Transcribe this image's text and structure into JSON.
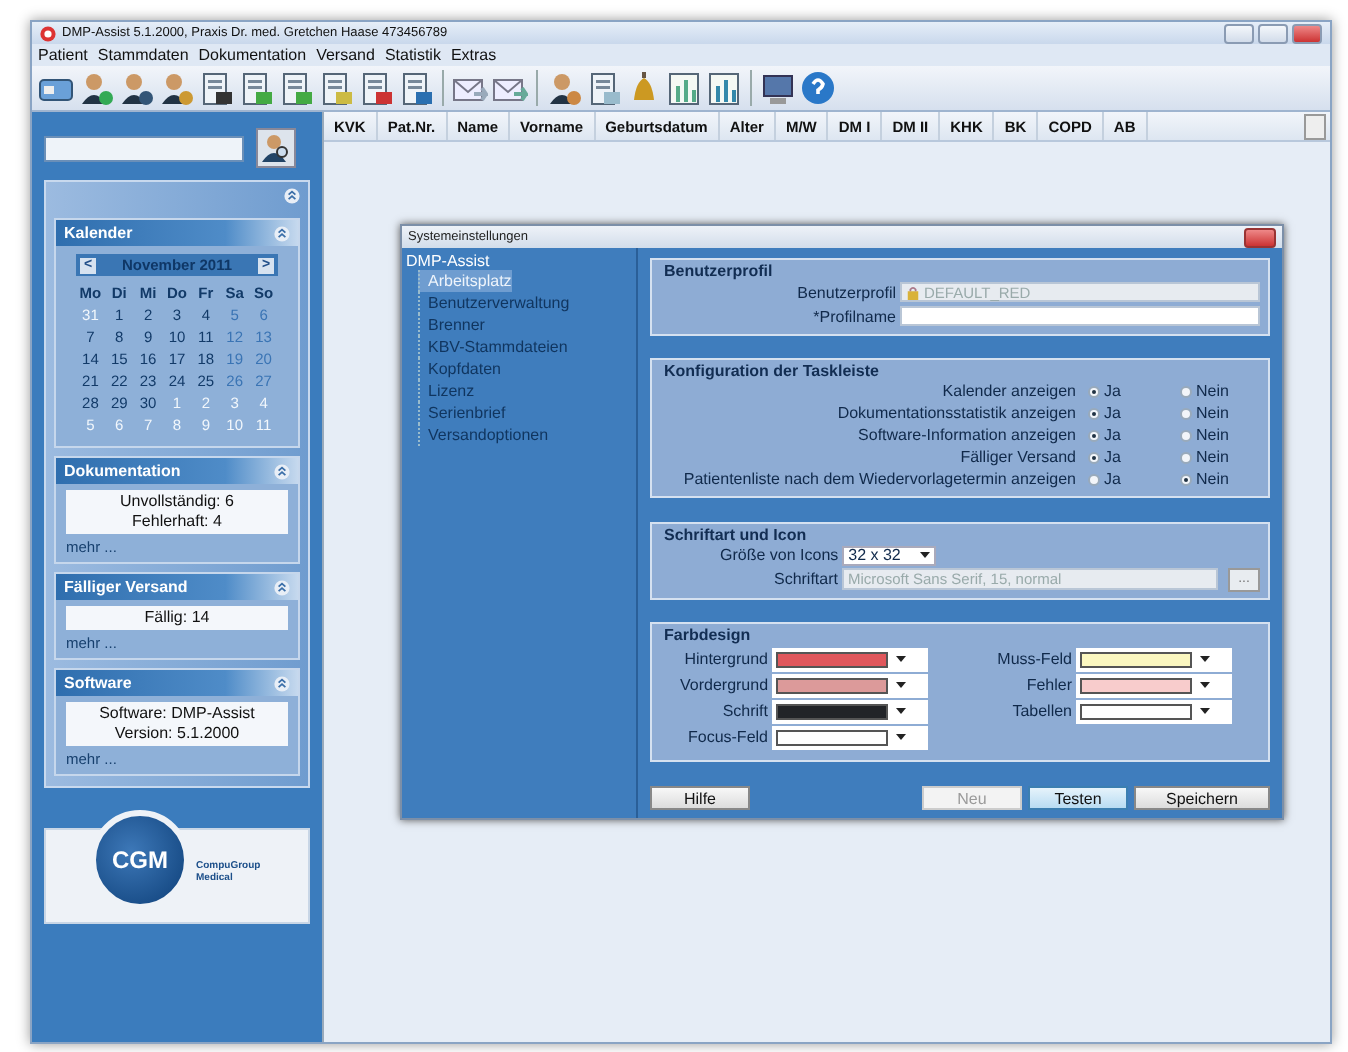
{
  "window": {
    "title": "DMP-Assist 5.1.2000, Praxis Dr. med. Gretchen Haase 473456789"
  },
  "menu": [
    "Patient",
    "Stammdaten",
    "Dokumentation",
    "Versand",
    "Statistik",
    "Extras"
  ],
  "sidebar": {
    "calendar": {
      "title": "Kalender",
      "month": "November 2011",
      "prev": "<",
      "next": ">",
      "weekdays": [
        "Mo",
        "Di",
        "Mi",
        "Do",
        "Fr",
        "Sa",
        "So"
      ],
      "weeks": [
        [
          {
            "day": "31",
            "muted": true
          },
          {
            "day": "1",
            "muted": false
          },
          {
            "day": "2",
            "muted": false
          },
          {
            "day": "3",
            "muted": false
          },
          {
            "day": "4",
            "muted": false
          },
          {
            "day": "5",
            "muted": false
          },
          {
            "day": "6",
            "muted": false
          }
        ],
        [
          {
            "day": "7",
            "muted": false
          },
          {
            "day": "8",
            "muted": false
          },
          {
            "day": "9",
            "muted": false
          },
          {
            "day": "10",
            "muted": false
          },
          {
            "day": "11",
            "muted": false
          },
          {
            "day": "12",
            "muted": false
          },
          {
            "day": "13",
            "muted": false
          }
        ],
        [
          {
            "day": "14",
            "muted": false
          },
          {
            "day": "15",
            "muted": false
          },
          {
            "day": "16",
            "muted": false
          },
          {
            "day": "17",
            "muted": false
          },
          {
            "day": "18",
            "muted": false
          },
          {
            "day": "19",
            "muted": false
          },
          {
            "day": "20",
            "muted": false
          }
        ],
        [
          {
            "day": "21",
            "muted": false
          },
          {
            "day": "22",
            "muted": false
          },
          {
            "day": "23",
            "muted": false
          },
          {
            "day": "24",
            "muted": false
          },
          {
            "day": "25",
            "muted": false
          },
          {
            "day": "26",
            "muted": false
          },
          {
            "day": "27",
            "muted": false
          }
        ],
        [
          {
            "day": "28",
            "muted": false
          },
          {
            "day": "29",
            "muted": false
          },
          {
            "day": "30",
            "muted": false
          },
          {
            "day": "1",
            "muted": true
          },
          {
            "day": "2",
            "muted": true
          },
          {
            "day": "3",
            "muted": true
          },
          {
            "day": "4",
            "muted": true
          }
        ],
        [
          {
            "day": "5",
            "muted": true
          },
          {
            "day": "6",
            "muted": true
          },
          {
            "day": "7",
            "muted": true
          },
          {
            "day": "8",
            "muted": true
          },
          {
            "day": "9",
            "muted": true
          },
          {
            "day": "10",
            "muted": true
          },
          {
            "day": "11",
            "muted": true
          }
        ]
      ]
    },
    "sections": [
      {
        "title": "Dokumentation",
        "lines": [
          "Unvollständig: 6",
          "Fehlerhaft: 4"
        ],
        "link": "mehr ..."
      },
      {
        "title": "Fälliger Versand",
        "lines": [
          "Fällig: 14"
        ],
        "link": "mehr ..."
      },
      {
        "title": "Software",
        "lines": [
          "Software: DMP-Assist",
          "Version: 5.1.2000"
        ],
        "link": "mehr ..."
      }
    ],
    "logo": {
      "mark": "CGM",
      "name": "CompuGroup Medical"
    }
  },
  "table": {
    "columns": [
      "KVK",
      "Pat.Nr.",
      "Name",
      "Vorname",
      "Geburtsdatum",
      "Alter",
      "M/W",
      "DM I",
      "DM II",
      "KHK",
      "BK",
      "COPD",
      "AB"
    ]
  },
  "dialog": {
    "title": "Systemeinstellungen",
    "tree": {
      "label": "DMP-Assist",
      "children": [
        {
          "label": "Arbeitsplatz",
          "selected": true
        },
        {
          "label": "Benutzerverwaltung",
          "selected": false
        },
        {
          "label": "Brenner",
          "selected": false
        },
        {
          "label": "KBV-Stammdateien",
          "selected": false
        },
        {
          "label": "Kopfdaten",
          "selected": false
        },
        {
          "label": "Lizenz",
          "selected": false
        },
        {
          "label": "Serienbrief",
          "selected": false
        },
        {
          "label": "Versandoptionen",
          "selected": false
        }
      ]
    },
    "profile": {
      "title": "Benutzerprofil",
      "profile_label": "Benutzerprofil",
      "profile_value": "DEFAULT_RED",
      "name_label": "*Profilname"
    },
    "taskbar": {
      "title": "Konfiguration der Taskleiste",
      "rows": [
        {
          "label": "Kalender anzeigen",
          "options": [
            {
              "label": "Ja",
              "selected": true
            },
            {
              "label": "Nein",
              "selected": false
            }
          ]
        },
        {
          "label": "Dokumentationsstatistik anzeigen",
          "options": [
            {
              "label": "Ja",
              "selected": true
            },
            {
              "label": "Nein",
              "selected": false
            }
          ]
        },
        {
          "label": "Software-Information anzeigen",
          "options": [
            {
              "label": "Ja",
              "selected": true
            },
            {
              "label": "Nein",
              "selected": false
            }
          ]
        },
        {
          "label": "Fälliger Versand",
          "options": [
            {
              "label": "Ja",
              "selected": true
            },
            {
              "label": "Nein",
              "selected": false
            }
          ]
        },
        {
          "label": "Patientenliste nach dem Wiedervorlagetermin anzeigen",
          "options": [
            {
              "label": "Ja",
              "selected": false
            },
            {
              "label": "Nein",
              "selected": true
            }
          ]
        }
      ]
    },
    "font": {
      "title": "Schriftart und Icon",
      "icons_label": "Größe von Icons",
      "icons_value": "32 x 32",
      "font_label": "Schriftart",
      "font_value": "Microsoft Sans Serif, 15, normal",
      "browse": "..."
    },
    "colors": {
      "title": "Farbdesign",
      "left": [
        {
          "label": "Hintergrund",
          "color": "#e0575c"
        },
        {
          "label": "Vordergrund",
          "color": "#dc9a9a"
        },
        {
          "label": "Schrift",
          "color": "#222428"
        },
        {
          "label": "Focus-Feld",
          "color": "#ffffff"
        }
      ],
      "right": [
        {
          "label": "Muss-Feld",
          "color": "#fbf7c0"
        },
        {
          "label": "Fehler",
          "color": "#f8cccc"
        },
        {
          "label": "Tabellen",
          "color": "#ffffff"
        }
      ]
    },
    "buttons": [
      {
        "label": "Hilfe",
        "disabled": false,
        "default": false
      },
      {
        "label": "Neu",
        "disabled": true,
        "default": false
      },
      {
        "label": "Testen",
        "disabled": false,
        "default": true
      },
      {
        "label": "Speichern",
        "disabled": false,
        "default": false
      }
    ]
  }
}
